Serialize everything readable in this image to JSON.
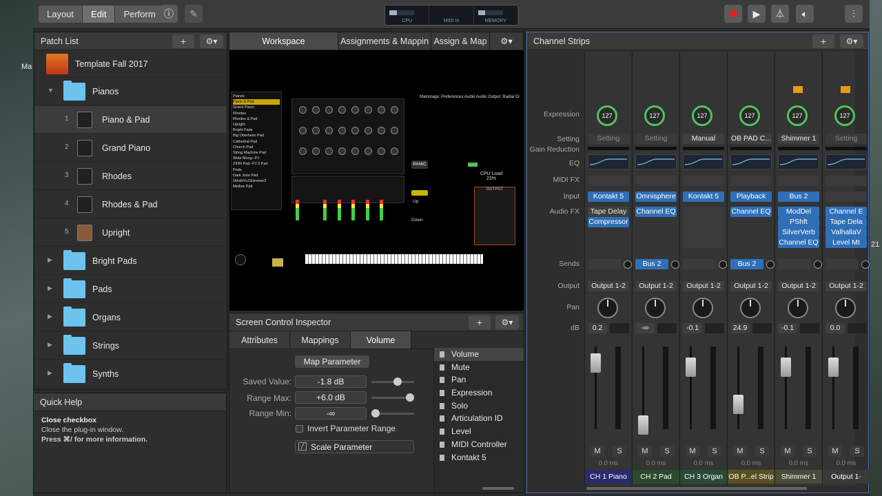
{
  "toolbar": {
    "layout": "Layout",
    "edit": "Edit",
    "perform": "Perform",
    "cpu": "CPU",
    "midi_in": "MIDI In",
    "memory": "MEMORY"
  },
  "patch_list": {
    "title": "Patch List",
    "concert": "Template Fall 2017",
    "rows": [
      {
        "label": "Pianos",
        "num": ""
      },
      {
        "label": "Piano & Pad",
        "num": "1"
      },
      {
        "label": "Grand Piano",
        "num": "2"
      },
      {
        "label": "Rhodes",
        "num": "3"
      },
      {
        "label": "Rhodes & Pad",
        "num": "4"
      },
      {
        "label": "Upright",
        "num": "5"
      },
      {
        "label": "Bright Pads",
        "num": ""
      },
      {
        "label": "Pads",
        "num": ""
      },
      {
        "label": "Organs",
        "num": ""
      },
      {
        "label": "Strings",
        "num": ""
      },
      {
        "label": "Synths",
        "num": ""
      }
    ]
  },
  "quick_help": {
    "title": "Quick Help",
    "heading": "Close checkbox",
    "body": "Close the plug-in window.",
    "hint": "Press ⌘/ for more information."
  },
  "workspace": {
    "tab1": "Workspace",
    "tab2": "Assignments & Mappin",
    "tab3": "Assign & Map",
    "panic": "PANIC",
    "up": "Up",
    "down": "Down",
    "cpu_load": "CPU Load",
    "cpu_pct": "23%",
    "output": "OUTPUT",
    "prefs": "Mainstage: Preferences:Audio:Audio Output: Radial Di",
    "mini_list": [
      "Pianos",
      "Piano & Pad",
      "Grand Piano",
      "Rhodes",
      "Rhodes & Pad",
      "Upright",
      "Bright Pads",
      "Big Oberheim Pad",
      "Cathedral Pad",
      "Church Pad",
      "String Machine Pad",
      "Wide Moog--PJ",
      "ZION Pad--PJ 3 Part",
      "Pads",
      "Dark Juno Pad",
      "OthdrIVc/Shimmer2",
      "Mellow Pad"
    ]
  },
  "inspector": {
    "title": "Screen Control Inspector",
    "tabs": [
      "Attributes",
      "Mappings",
      "Volume"
    ],
    "map_parameter": "Map Parameter",
    "saved_value_label": "Saved Value:",
    "saved_value": "-1.8 dB",
    "range_max_label": "Range Max:",
    "range_max": "+6.0 dB",
    "range_min_label": "Range Min:",
    "range_min": "-∞",
    "invert": "Invert Parameter Range",
    "scale": "Scale Parameter",
    "params": [
      "Volume",
      "Mute",
      "Pan",
      "Expression",
      "Solo",
      "Articulation ID",
      "Level",
      "MIDI Controller",
      "Kontakt 5"
    ]
  },
  "channel_strips": {
    "title": "Channel Strips",
    "row_labels": {
      "expression": "Expression",
      "setting": "Setting",
      "gain_reduction": "Gain Reduction",
      "eq": "EQ",
      "midi_fx": "MIDI FX",
      "input": "Input",
      "audio_fx": "Audio FX",
      "sends": "Sends",
      "output": "Output",
      "pan": "Pan",
      "db": "dB"
    },
    "strips": [
      {
        "expr": "127",
        "setting": "Setting",
        "input": "Kontakt 5",
        "fx": [
          "Tape Delay",
          "Compressor"
        ],
        "send": "",
        "output": "Output 1-2",
        "db": "0.2",
        "peak": "0.0 ms",
        "name": "CH 1 Piano",
        "color": "#2a2a6e",
        "fader": 0.8,
        "m": "M",
        "s": "S"
      },
      {
        "expr": "127",
        "setting": "Setting",
        "input": "Omnisphere",
        "fx": [
          "Channel EQ"
        ],
        "send": "Bus 2",
        "output": "Output 1-2",
        "db": "-∞",
        "peak": "0.0 ms",
        "name": "CH 2 Pad",
        "color": "#2b4a2b",
        "fader": 0.05,
        "m": "M",
        "s": "S"
      },
      {
        "expr": "127",
        "setting": "Manual",
        "input": "Kontakt 5",
        "fx": [],
        "send": "",
        "output": "Output 1-2",
        "db": "-0.1",
        "peak": "0.0 ms",
        "name": "CH 3 Organ",
        "color": "#2a4a38",
        "fader": 0.75,
        "m": "M",
        "s": "S"
      },
      {
        "expr": "127",
        "setting": "OB PAD C...",
        "input": "Playback",
        "fx": [
          "Channel EQ"
        ],
        "send": "Bus 2",
        "output": "Output 1-2",
        "db": "24.9",
        "peak": "0.0 ms",
        "name": "OB P...el Strip",
        "color": "#5a4f20",
        "fader": 0.3,
        "m": "M",
        "s": "S"
      },
      {
        "expr": "127",
        "setting": "Shimmer 1",
        "input": "Bus 2",
        "fx": [
          "ModDel",
          "PShft",
          "SilverVerb",
          "Channel EQ"
        ],
        "send": "",
        "output": "Output 1-2",
        "db": "-0.1",
        "peak": "0.0 ms",
        "name": "Shimmer 1",
        "color": "#4a4a3a",
        "fader": 0.75,
        "m": "M",
        "s": "S"
      },
      {
        "expr": "127",
        "setting": "Setting",
        "input": "",
        "fx": [
          "Channel E",
          "Tape Dela",
          "ValhallaV",
          "Level Mt"
        ],
        "send": "",
        "output": "Output 1-2",
        "db": "0.0",
        "peak": "0.0 ms",
        "name": "Output 1-",
        "color": "#3a3a3a",
        "fader": 0.75,
        "m": "M",
        "s": "S"
      }
    ]
  }
}
